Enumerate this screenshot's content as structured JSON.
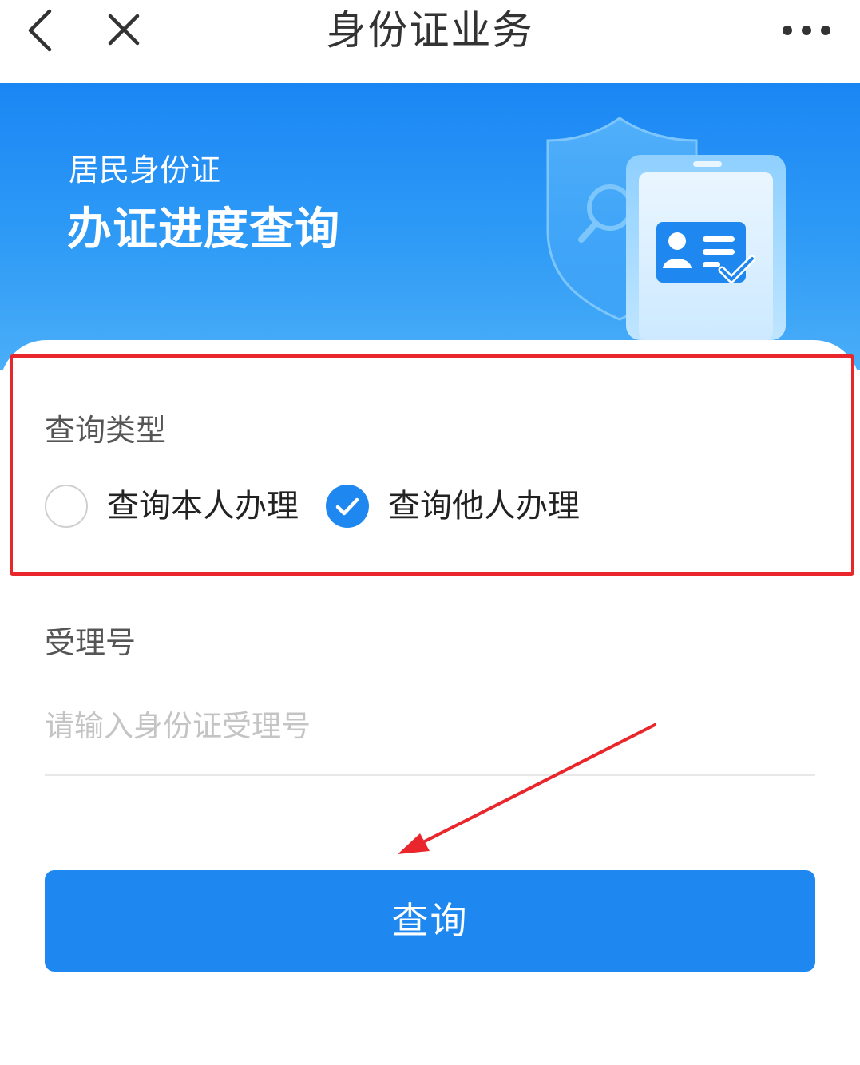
{
  "navbar": {
    "title": "身份证业务",
    "back_icon": "chevron-left-icon",
    "close_icon": "close-icon",
    "more_icon": "more-horizontal-icon"
  },
  "banner": {
    "subtitle": "居民身份证",
    "title": "办证进度查询",
    "illustration": "id-card-shield-icon"
  },
  "form": {
    "query_type_label": "查询类型",
    "options": [
      {
        "label": "查询本人办理",
        "selected": false
      },
      {
        "label": "查询他人办理",
        "selected": true
      }
    ],
    "acceptance_label": "受理号",
    "acceptance_input": {
      "value": "",
      "placeholder": "请输入身份证受理号"
    },
    "submit_label": "查询"
  },
  "colors": {
    "primary": "#1e88f0",
    "highlight_border": "#e8262b",
    "annotation_arrow": "#e8262b"
  }
}
